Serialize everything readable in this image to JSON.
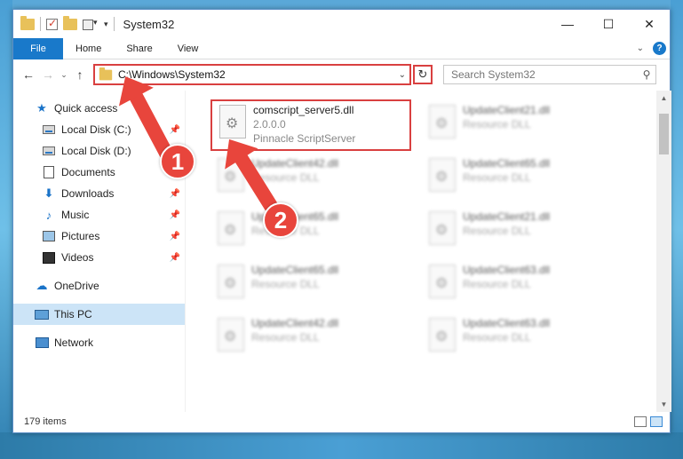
{
  "window": {
    "title": "System32"
  },
  "ribbon": {
    "tabs": [
      "File",
      "Home",
      "Share",
      "View"
    ]
  },
  "address": {
    "path": "C:\\Windows\\System32",
    "search_placeholder": "Search System32"
  },
  "nav": {
    "items": [
      {
        "label": "Quick access",
        "icon": "star-icon"
      },
      {
        "label": "Local Disk (C:)",
        "icon": "drive-icon"
      },
      {
        "label": "Local Disk (D:)",
        "icon": "drive-icon"
      },
      {
        "label": "Documents",
        "icon": "documents-icon"
      },
      {
        "label": "Downloads",
        "icon": "download-icon"
      },
      {
        "label": "Music",
        "icon": "music-icon"
      },
      {
        "label": "Pictures",
        "icon": "pictures-icon"
      },
      {
        "label": "Videos",
        "icon": "videos-icon"
      },
      {
        "label": "OneDrive",
        "icon": "cloud-icon"
      },
      {
        "label": "This PC",
        "icon": "computer-icon"
      },
      {
        "label": "Network",
        "icon": "network-icon"
      }
    ]
  },
  "files": [
    {
      "name": "comscript_server5.dll",
      "line2": "2.0.0.0",
      "line3": "Pinnacle ScriptServer"
    },
    {
      "name": "UpdateClient21.dll",
      "line2": "Resource DLL"
    },
    {
      "name": "UpdateClient42.dll",
      "line2": "Resource DLL"
    },
    {
      "name": "UpdateClient65.dll",
      "line2": "Resource DLL"
    },
    {
      "name": "UpdateClient65.dll",
      "line2": "Resource DLL"
    },
    {
      "name": "UpdateClient21.dll",
      "line2": "Resource DLL"
    },
    {
      "name": "UpdateClient65.dll",
      "line2": "Resource DLL"
    },
    {
      "name": "UpdateClient63.dll",
      "line2": "Resource DLL"
    },
    {
      "name": "UpdateClient42.dll",
      "line2": "Resource DLL"
    },
    {
      "name": "UpdateClient63.dll",
      "line2": "Resource DLL"
    }
  ],
  "status": {
    "count": "179 items"
  },
  "annotations": {
    "step1": "1",
    "step2": "2"
  },
  "colors": {
    "accent": "#1979ca",
    "annotation": "#e8453c",
    "highlight_border": "#d94040"
  }
}
